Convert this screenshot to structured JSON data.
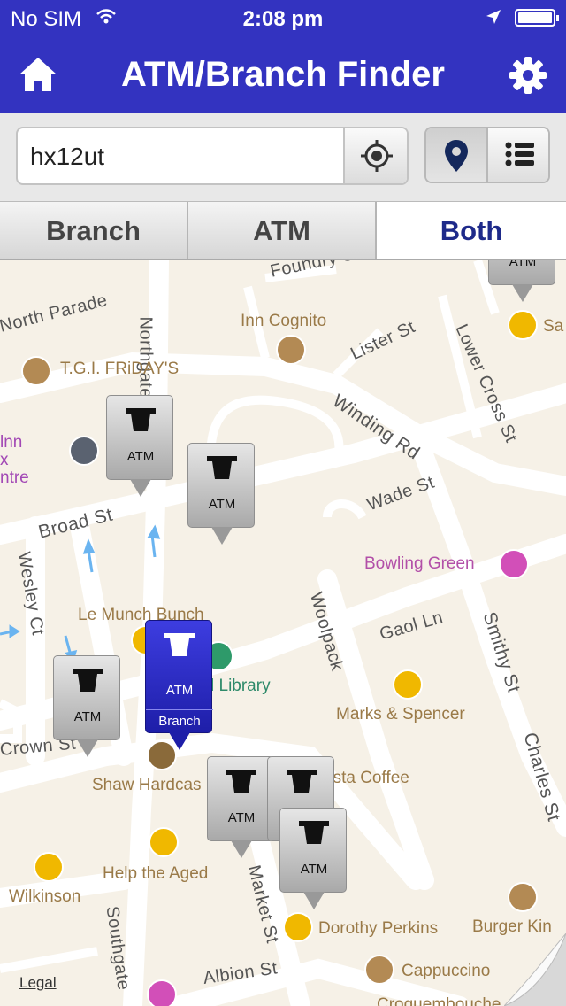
{
  "status_bar": {
    "carrier": "No SIM",
    "time": "2:08 pm",
    "battery_level": 0.9
  },
  "nav": {
    "title": "ATM/Branch Finder",
    "home_icon": "home-icon",
    "settings_icon": "gear-icon"
  },
  "search": {
    "value": "hx12ut",
    "placeholder": ""
  },
  "view_toggle": {
    "selected": "map"
  },
  "filter": {
    "branch": "Branch",
    "atm": "ATM",
    "both": "Both",
    "selected": "Both"
  },
  "map": {
    "streets": {
      "foundry": "Foundry St",
      "north_parade": "North Parade",
      "northgate": "Northgate",
      "lister": "Lister St",
      "lower_cross": "Lower Cross St",
      "winding": "Winding Rd",
      "broad": "Broad St",
      "wade": "Wade St",
      "wesley": "Wesley Ct",
      "gaol": "Gaol Ln",
      "woolpack": "Woolpack",
      "smithy": "Smithy St",
      "charles": "Charles St",
      "crown": "Crown St",
      "market": "Market St",
      "southgate": "Southgate",
      "albion": "Albion St"
    },
    "pois": {
      "inn_cognito": "Inn Cognito",
      "tgi": "T.G.I. FRiDAY'S",
      "inn_line1": "lnn",
      "inn_line2": "x",
      "centre": "ntre",
      "sa": "Sa",
      "bowling": "Bowling Green",
      "munch": "Le Munch Bunch",
      "library": "l Library",
      "marks": "Marks & Spencer",
      "shaw": "Shaw Hardcas",
      "costa": "osta Coffee",
      "help": "Help the Aged",
      "wilkinson": "Wilkinson",
      "dorothy": "Dorothy Perkins",
      "burger": "Burger Kin",
      "cappuccino": "Cappuccino",
      "croque": "Croquembouche"
    },
    "pins": {
      "atm_label": "ATM",
      "branch_label": "Branch"
    },
    "legal": "Legal"
  }
}
